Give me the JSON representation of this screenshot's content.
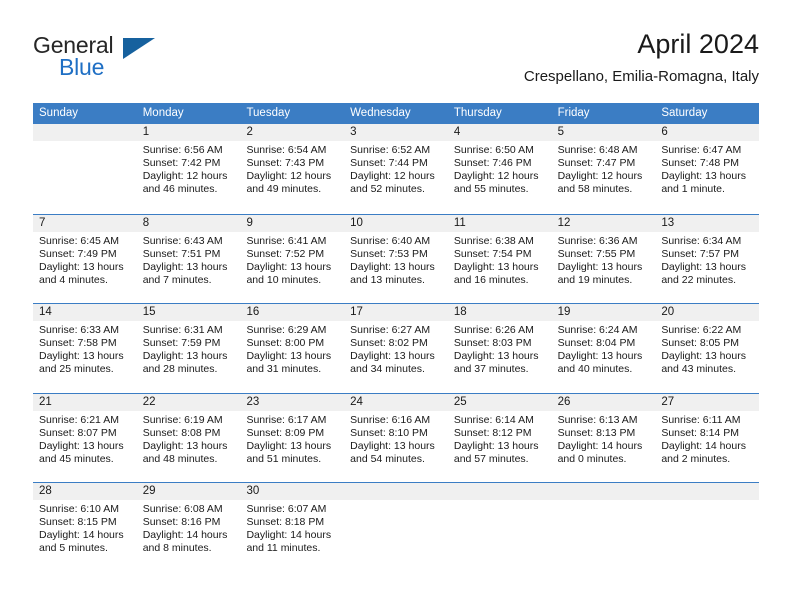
{
  "brand": {
    "name_part1": "General",
    "name_part2": "Blue",
    "logo_icon": "triangle-logo-icon",
    "accent_color": "#1f6fc4"
  },
  "header": {
    "title": "April 2024",
    "subtitle": "Crespellano, Emilia-Romagna, Italy"
  },
  "calendar": {
    "header_bg_color": "#3b7dc4",
    "day_band_color": "#f0f0f0",
    "weekdays": [
      "Sunday",
      "Monday",
      "Tuesday",
      "Wednesday",
      "Thursday",
      "Friday",
      "Saturday"
    ],
    "weeks": [
      [
        {
          "day": "",
          "empty": true
        },
        {
          "day": "1",
          "sunrise": "Sunrise: 6:56 AM",
          "sunset": "Sunset: 7:42 PM",
          "daylight": "Daylight: 12 hours and 46 minutes."
        },
        {
          "day": "2",
          "sunrise": "Sunrise: 6:54 AM",
          "sunset": "Sunset: 7:43 PM",
          "daylight": "Daylight: 12 hours and 49 minutes."
        },
        {
          "day": "3",
          "sunrise": "Sunrise: 6:52 AM",
          "sunset": "Sunset: 7:44 PM",
          "daylight": "Daylight: 12 hours and 52 minutes."
        },
        {
          "day": "4",
          "sunrise": "Sunrise: 6:50 AM",
          "sunset": "Sunset: 7:46 PM",
          "daylight": "Daylight: 12 hours and 55 minutes."
        },
        {
          "day": "5",
          "sunrise": "Sunrise: 6:48 AM",
          "sunset": "Sunset: 7:47 PM",
          "daylight": "Daylight: 12 hours and 58 minutes."
        },
        {
          "day": "6",
          "sunrise": "Sunrise: 6:47 AM",
          "sunset": "Sunset: 7:48 PM",
          "daylight": "Daylight: 13 hours and 1 minute."
        }
      ],
      [
        {
          "day": "7",
          "sunrise": "Sunrise: 6:45 AM",
          "sunset": "Sunset: 7:49 PM",
          "daylight": "Daylight: 13 hours and 4 minutes."
        },
        {
          "day": "8",
          "sunrise": "Sunrise: 6:43 AM",
          "sunset": "Sunset: 7:51 PM",
          "daylight": "Daylight: 13 hours and 7 minutes."
        },
        {
          "day": "9",
          "sunrise": "Sunrise: 6:41 AM",
          "sunset": "Sunset: 7:52 PM",
          "daylight": "Daylight: 13 hours and 10 minutes."
        },
        {
          "day": "10",
          "sunrise": "Sunrise: 6:40 AM",
          "sunset": "Sunset: 7:53 PM",
          "daylight": "Daylight: 13 hours and 13 minutes."
        },
        {
          "day": "11",
          "sunrise": "Sunrise: 6:38 AM",
          "sunset": "Sunset: 7:54 PM",
          "daylight": "Daylight: 13 hours and 16 minutes."
        },
        {
          "day": "12",
          "sunrise": "Sunrise: 6:36 AM",
          "sunset": "Sunset: 7:55 PM",
          "daylight": "Daylight: 13 hours and 19 minutes."
        },
        {
          "day": "13",
          "sunrise": "Sunrise: 6:34 AM",
          "sunset": "Sunset: 7:57 PM",
          "daylight": "Daylight: 13 hours and 22 minutes."
        }
      ],
      [
        {
          "day": "14",
          "sunrise": "Sunrise: 6:33 AM",
          "sunset": "Sunset: 7:58 PM",
          "daylight": "Daylight: 13 hours and 25 minutes."
        },
        {
          "day": "15",
          "sunrise": "Sunrise: 6:31 AM",
          "sunset": "Sunset: 7:59 PM",
          "daylight": "Daylight: 13 hours and 28 minutes."
        },
        {
          "day": "16",
          "sunrise": "Sunrise: 6:29 AM",
          "sunset": "Sunset: 8:00 PM",
          "daylight": "Daylight: 13 hours and 31 minutes."
        },
        {
          "day": "17",
          "sunrise": "Sunrise: 6:27 AM",
          "sunset": "Sunset: 8:02 PM",
          "daylight": "Daylight: 13 hours and 34 minutes."
        },
        {
          "day": "18",
          "sunrise": "Sunrise: 6:26 AM",
          "sunset": "Sunset: 8:03 PM",
          "daylight": "Daylight: 13 hours and 37 minutes."
        },
        {
          "day": "19",
          "sunrise": "Sunrise: 6:24 AM",
          "sunset": "Sunset: 8:04 PM",
          "daylight": "Daylight: 13 hours and 40 minutes."
        },
        {
          "day": "20",
          "sunrise": "Sunrise: 6:22 AM",
          "sunset": "Sunset: 8:05 PM",
          "daylight": "Daylight: 13 hours and 43 minutes."
        }
      ],
      [
        {
          "day": "21",
          "sunrise": "Sunrise: 6:21 AM",
          "sunset": "Sunset: 8:07 PM",
          "daylight": "Daylight: 13 hours and 45 minutes."
        },
        {
          "day": "22",
          "sunrise": "Sunrise: 6:19 AM",
          "sunset": "Sunset: 8:08 PM",
          "daylight": "Daylight: 13 hours and 48 minutes."
        },
        {
          "day": "23",
          "sunrise": "Sunrise: 6:17 AM",
          "sunset": "Sunset: 8:09 PM",
          "daylight": "Daylight: 13 hours and 51 minutes."
        },
        {
          "day": "24",
          "sunrise": "Sunrise: 6:16 AM",
          "sunset": "Sunset: 8:10 PM",
          "daylight": "Daylight: 13 hours and 54 minutes."
        },
        {
          "day": "25",
          "sunrise": "Sunrise: 6:14 AM",
          "sunset": "Sunset: 8:12 PM",
          "daylight": "Daylight: 13 hours and 57 minutes."
        },
        {
          "day": "26",
          "sunrise": "Sunrise: 6:13 AM",
          "sunset": "Sunset: 8:13 PM",
          "daylight": "Daylight: 14 hours and 0 minutes."
        },
        {
          "day": "27",
          "sunrise": "Sunrise: 6:11 AM",
          "sunset": "Sunset: 8:14 PM",
          "daylight": "Daylight: 14 hours and 2 minutes."
        }
      ],
      [
        {
          "day": "28",
          "sunrise": "Sunrise: 6:10 AM",
          "sunset": "Sunset: 8:15 PM",
          "daylight": "Daylight: 14 hours and 5 minutes."
        },
        {
          "day": "29",
          "sunrise": "Sunrise: 6:08 AM",
          "sunset": "Sunset: 8:16 PM",
          "daylight": "Daylight: 14 hours and 8 minutes."
        },
        {
          "day": "30",
          "sunrise": "Sunrise: 6:07 AM",
          "sunset": "Sunset: 8:18 PM",
          "daylight": "Daylight: 14 hours and 11 minutes."
        },
        {
          "day": "",
          "empty": true
        },
        {
          "day": "",
          "empty": true
        },
        {
          "day": "",
          "empty": true
        },
        {
          "day": "",
          "empty": true
        }
      ]
    ]
  }
}
